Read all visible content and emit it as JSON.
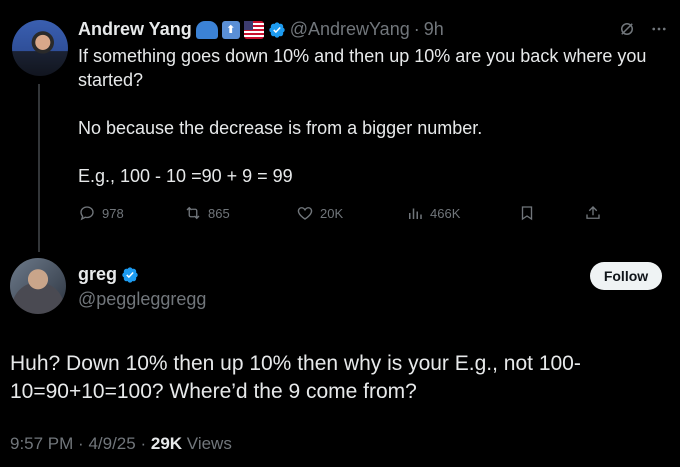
{
  "tweet": {
    "author_name": "Andrew Yang",
    "author_handle": "@AndrewYang",
    "dot": "·",
    "age": "9h",
    "paragraphs": [
      "If something goes down 10% and then up 10% are you back where you started?",
      "No because the decrease is from a bigger number.",
      "E.g., 100 - 10 =90 + 9 = 99"
    ],
    "actions": {
      "replies": "978",
      "reposts": "865",
      "likes": "20K",
      "views": "466K"
    },
    "name_emojis": [
      "blue-cap-emoji",
      "up-arrow-emoji",
      "us-flag-emoji"
    ]
  },
  "reply": {
    "author_name": "greg",
    "author_handle": "@peggleggregg",
    "follow_label": "Follow",
    "text": "Huh? Down 10% then up 10% then why is your E.g., not 100-10=90+10=100? Where’d the 9 come from?",
    "time": "9:57 PM",
    "date": "4/9/25",
    "dot": "·",
    "views_count": "29K",
    "views_label": "Views"
  },
  "colors": {
    "background": "#000000",
    "text": "#e7e9ea",
    "muted": "#71767b",
    "verified": "#1d9bf0",
    "follow_bg": "#eff3f4"
  }
}
